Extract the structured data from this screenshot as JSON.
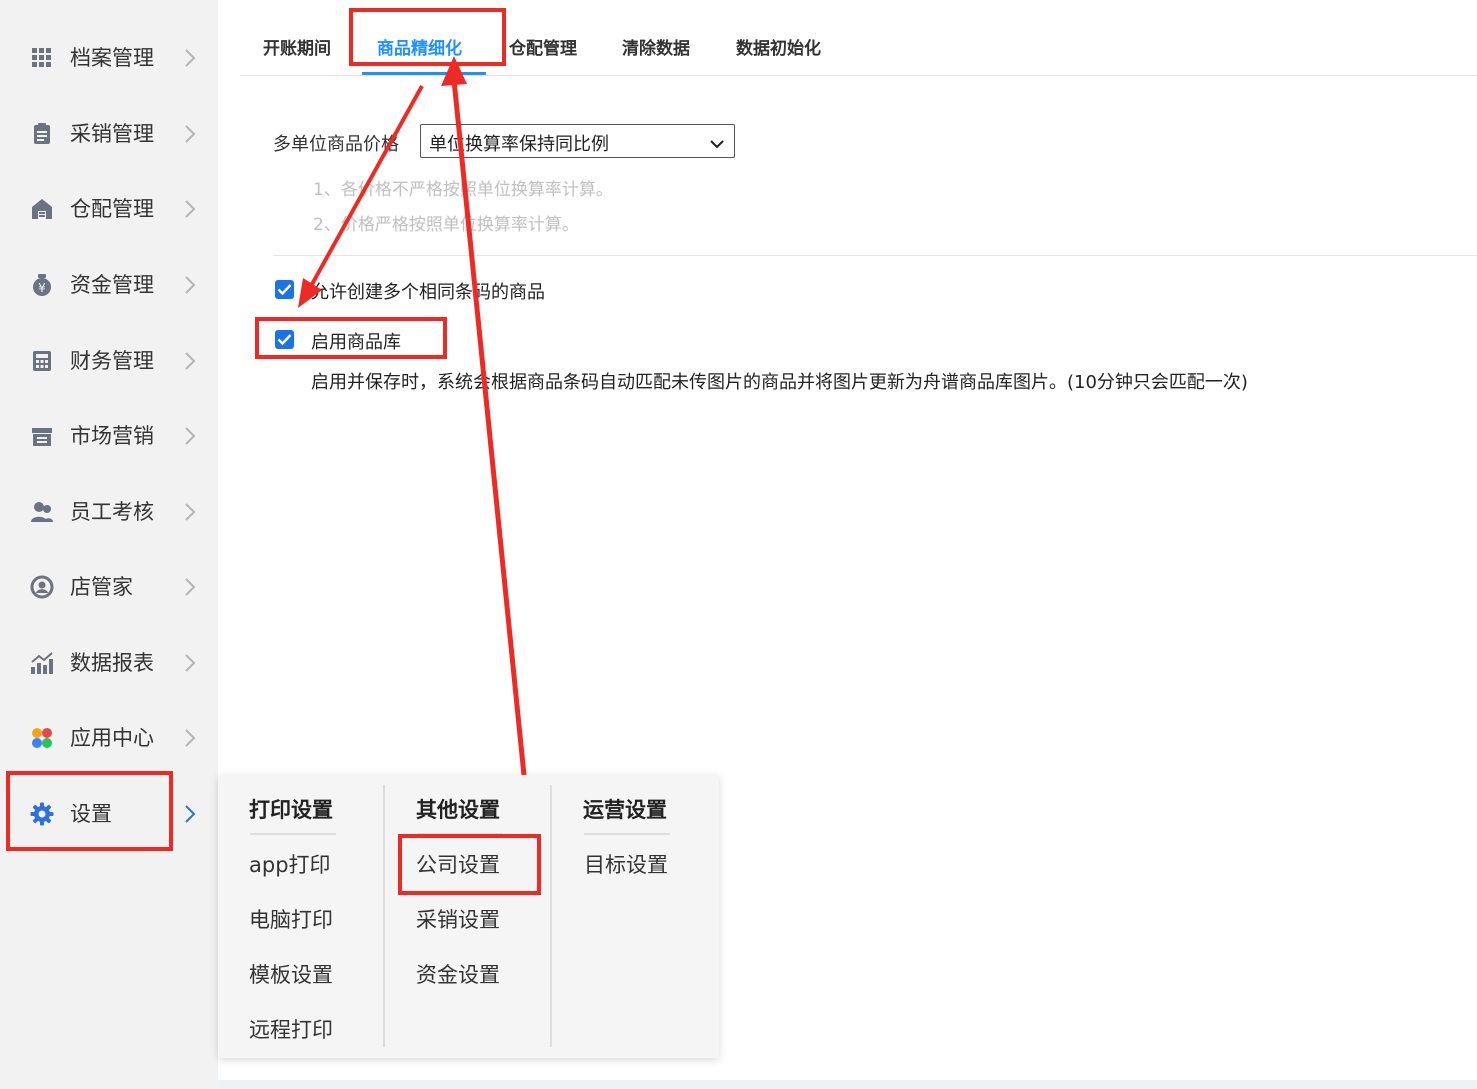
{
  "sidebar": {
    "items": [
      {
        "label": "档案管理",
        "icon": "grid-icon"
      },
      {
        "label": "采销管理",
        "icon": "clipboard-icon"
      },
      {
        "label": "仓配管理",
        "icon": "warehouse-icon"
      },
      {
        "label": "资金管理",
        "icon": "money-bag-icon"
      },
      {
        "label": "财务管理",
        "icon": "calculator-icon"
      },
      {
        "label": "市场营销",
        "icon": "store-icon"
      },
      {
        "label": "员工考核",
        "icon": "people-icon"
      },
      {
        "label": "店管家",
        "icon": "manager-icon"
      },
      {
        "label": "数据报表",
        "icon": "bar-chart-icon"
      },
      {
        "label": "应用中心",
        "icon": "apps-icon"
      },
      {
        "label": "设置",
        "icon": "gear-icon"
      }
    ]
  },
  "tabs": [
    {
      "label": "开账期间"
    },
    {
      "label": "商品精细化"
    },
    {
      "label": "仓配管理"
    },
    {
      "label": "清除数据"
    },
    {
      "label": "数据初始化"
    }
  ],
  "content": {
    "price_label": "多单位商品价格",
    "price_select_value": "单位换算率保持同比例",
    "hint1": "1、各价格不严格按照单位换算率计算。",
    "hint2": "2、价格严格按照单位换算率计算。",
    "checkbox_barcode": "允许创建多个相同条码的商品",
    "checkbox_library": "启用商品库",
    "library_desc": "启用并保存时，系统会根据商品条码自动匹配未传图片的商品并将图片更新为舟谱商品库图片。(10分钟只会匹配一次)"
  },
  "popup": {
    "columns": [
      {
        "title": "打印设置",
        "items": [
          "app打印",
          "电脑打印",
          "模板设置",
          "远程打印"
        ]
      },
      {
        "title": "其他设置",
        "items": [
          "公司设置",
          "采销设置",
          "资金设置"
        ]
      },
      {
        "title": "运营设置",
        "items": [
          "目标设置"
        ]
      }
    ]
  },
  "colors": {
    "accent": "#1e90ff",
    "annotation_red": "#ee2a24",
    "icon_gray": "#6b7280",
    "settings_blue": "#2f6fde"
  }
}
